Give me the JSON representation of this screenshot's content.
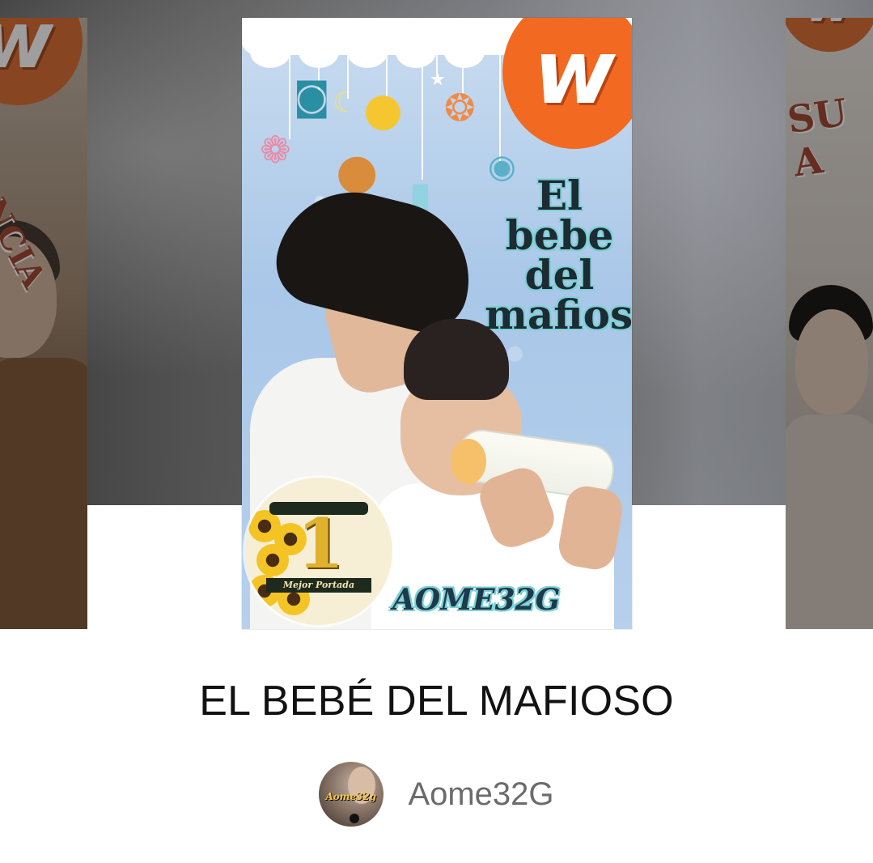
{
  "carousel": {
    "left_cover": {
      "logo_letter": "w",
      "fragment_text": "NCIA"
    },
    "right_cover": {
      "logo_letter": "w",
      "fragment_text": "SU A"
    },
    "main_cover": {
      "logo_letter": "w",
      "title_lines": [
        "El",
        "bebe",
        "del",
        "mafioso"
      ],
      "award": {
        "number": "1",
        "label": "Mejor Portada"
      },
      "signature": "AOME32G"
    }
  },
  "story": {
    "title": "EL BEBÉ DEL MAFIOSO",
    "author": "Aome32G"
  },
  "author_avatar": {
    "text": "Aome32g"
  },
  "colors": {
    "brand_orange": "#f26a22",
    "title_text": "#121212",
    "author_text": "#6b6b6b"
  }
}
